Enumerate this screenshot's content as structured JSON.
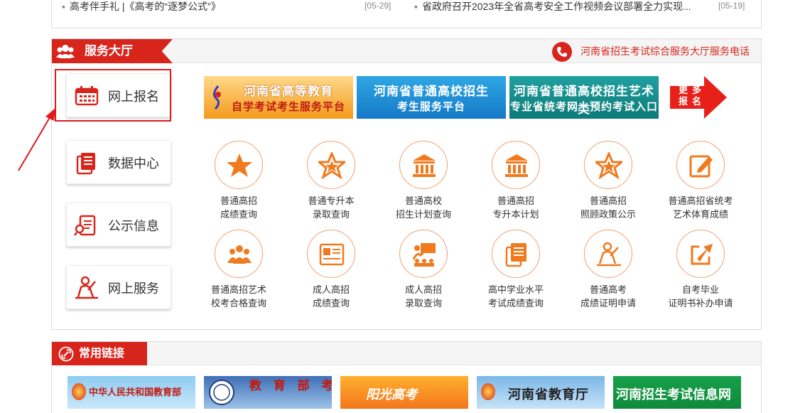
{
  "news": [
    {
      "title": "高考伴手礼 |《高考的“逐梦公式”》",
      "date": "[05-29]"
    },
    {
      "title": "省政府召开2023年全省高考安全工作视频会议部署全力实现...",
      "date": "[05-19]"
    }
  ],
  "service": {
    "title": "服务大厅",
    "hotline": "河南省招生考试综合服务大厅服务电话",
    "side": [
      {
        "label": "网上报名",
        "icon": "calendar-icon"
      },
      {
        "label": "数据中心",
        "icon": "document-stack-icon"
      },
      {
        "label": "公示信息",
        "icon": "notice-icon"
      },
      {
        "label": "网上服务",
        "icon": "person-service-icon"
      }
    ],
    "banners": [
      {
        "line1": "河南省高等教育",
        "line2": "自学考试考生服务平台"
      },
      {
        "line1": "河南省普通高校招生",
        "line2": "考生服务平台"
      },
      {
        "line1": "河南省普通高校招生艺术类",
        "line2": "专业省统考网上预约考试入口"
      }
    ],
    "more": {
      "line1": "更多",
      "line2": "报名"
    },
    "items": [
      {
        "l1": "普通高招",
        "l2": "成绩查询",
        "icon": "star-icon"
      },
      {
        "l1": "普通专升本",
        "l2": "录取查询",
        "icon": "star-outline-icon"
      },
      {
        "l1": "普通高校",
        "l2": "招生计划查询",
        "icon": "building-icon"
      },
      {
        "l1": "普通高招",
        "l2": "专升本计划",
        "icon": "building-icon"
      },
      {
        "l1": "普通高招",
        "l2": "照顾政策公示",
        "icon": "star-outline-icon"
      },
      {
        "l1": "普通高招省统考",
        "l2": "艺术体育成绩",
        "icon": "edit-icon"
      },
      {
        "l1": "普通高招艺术",
        "l2": "校考合格查询",
        "icon": "group-icon"
      },
      {
        "l1": "成人高招",
        "l2": "成绩查询",
        "icon": "certificate-icon"
      },
      {
        "l1": "成人高招",
        "l2": "录取查询",
        "icon": "presentation-icon"
      },
      {
        "l1": "高中学业水平",
        "l2": "考试成绩查询",
        "icon": "document-stack-icon"
      },
      {
        "l1": "普通高考",
        "l2": "成绩证明申请",
        "icon": "person-service-icon"
      },
      {
        "l1": "自考毕业",
        "l2": "证明书补办申请",
        "icon": "export-icon"
      }
    ]
  },
  "links": {
    "title": "常用链接",
    "items": [
      {
        "label": "中华人民共和国教育部"
      },
      {
        "label": "教 育 部 考 试 中 心"
      },
      {
        "label": "阳光高考"
      },
      {
        "label": "河南省教育厅"
      },
      {
        "label": "河南招生考试信息网"
      }
    ]
  }
}
